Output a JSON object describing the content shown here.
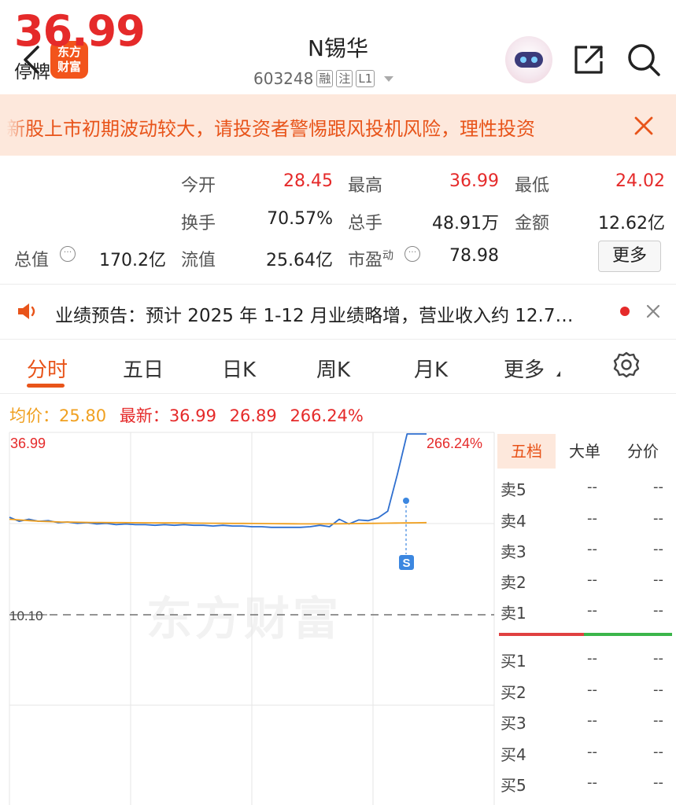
{
  "header": {
    "logo_line1": "东方",
    "logo_line2": "财富",
    "title": "N锡华",
    "code": "603248",
    "tags": [
      "融",
      "注",
      "L1"
    ]
  },
  "warning": {
    "text": "新股上市初期波动较大，请投资者警惕跟风投机风险，理性投资"
  },
  "quote": {
    "price": "36.99",
    "status": "停牌",
    "open_label": "今开",
    "open_value": "28.45",
    "high_label": "最高",
    "high_value": "36.99",
    "low_label": "最低",
    "low_value": "24.02",
    "turnover_label": "换手",
    "turnover_value": "70.57%",
    "volume_label": "总手",
    "volume_value": "48.91万",
    "amount_label": "金额",
    "amount_value": "12.62亿",
    "mktcap_label": "总值",
    "mktcap_value": "170.2亿",
    "float_label": "流值",
    "float_value": "25.64亿",
    "pe_label": "市盈",
    "pe_sup": "动",
    "pe_value": "78.98",
    "more_label": "更多"
  },
  "announcement": {
    "text": "业绩预告：预计 2025 年 1-12 月业绩略增，营业收入约 12.7…"
  },
  "tabs": [
    {
      "label": "分时",
      "active": true
    },
    {
      "label": "五日",
      "active": false
    },
    {
      "label": "日K",
      "active": false
    },
    {
      "label": "周K",
      "active": false
    },
    {
      "label": "月K",
      "active": false
    },
    {
      "label": "更多",
      "active": false
    }
  ],
  "chart_header": {
    "avg_label": "均价：",
    "avg_value": "25.80",
    "latest_label": "最新：",
    "latest_price": "36.99",
    "latest_change": "26.89",
    "latest_pct": "266.24%"
  },
  "chart_data": {
    "type": "line",
    "y_top_label": "36.99",
    "y_top_pct": "266.24%",
    "ref_label": "10.10",
    "y_range": [
      10.1,
      36.99
    ],
    "series": [
      {
        "color": "#2f6fcf",
        "values": [
          24.6,
          24.0,
          24.3,
          24.0,
          24.1,
          23.8,
          23.9,
          23.7,
          23.8,
          23.6,
          23.7,
          23.5,
          23.6,
          23.5,
          23.5,
          23.4,
          23.5,
          23.4,
          23.5,
          23.4,
          23.4,
          23.3,
          23.4,
          23.3,
          23.3,
          23.2,
          23.2,
          23.1,
          23.1,
          23.1,
          23.1,
          23.2,
          23.4,
          23.2,
          24.3,
          23.6,
          24.2,
          24.1,
          24.5,
          25.5,
          31.0,
          36.99,
          36.99,
          36.99
        ]
      },
      {
        "color": "#f0a020",
        "values": [
          24.3,
          24.2,
          24.1,
          24.0,
          23.95,
          23.9,
          23.88,
          23.85,
          23.83,
          23.82,
          23.8,
          23.8,
          23.79,
          23.78,
          23.77,
          23.76,
          23.75,
          23.74,
          23.73,
          23.72,
          23.71,
          23.7,
          23.69,
          23.68,
          23.67,
          23.66,
          23.65,
          23.64,
          23.63,
          23.62,
          23.61,
          23.62,
          23.63,
          23.64,
          23.66,
          23.68,
          23.7,
          23.72,
          23.74,
          23.76,
          23.78,
          23.8
        ]
      }
    ],
    "marker_label": "S",
    "grid": true
  },
  "order_book": {
    "tabs": [
      "五档",
      "大单",
      "分价"
    ],
    "sell": [
      {
        "label": "卖5",
        "price": "--",
        "vol": "--"
      },
      {
        "label": "卖4",
        "price": "--",
        "vol": "--"
      },
      {
        "label": "卖3",
        "price": "--",
        "vol": "--"
      },
      {
        "label": "卖2",
        "price": "--",
        "vol": "--"
      },
      {
        "label": "卖1",
        "price": "--",
        "vol": "--"
      }
    ],
    "buy": [
      {
        "label": "买1",
        "price": "--",
        "vol": "--"
      },
      {
        "label": "买2",
        "price": "--",
        "vol": "--"
      },
      {
        "label": "买3",
        "price": "--",
        "vol": "--"
      },
      {
        "label": "买4",
        "price": "--",
        "vol": "--"
      },
      {
        "label": "买5",
        "price": "--",
        "vol": "--"
      }
    ]
  },
  "watermark": "东方财富",
  "colors": {
    "accent": "#e8541a",
    "up": "#e52a2a",
    "down": "#3bb54a",
    "price_line": "#2f6fcf",
    "avg_line": "#f0a020"
  }
}
